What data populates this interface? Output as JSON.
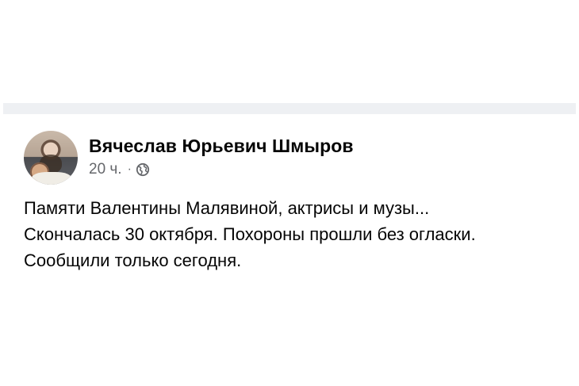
{
  "post": {
    "author": "Вячеслав Юрьевич Шмыров",
    "time": "20 ч.",
    "separator": "·",
    "privacy_icon": "globe-icon",
    "lines": [
      "Памяти Валентины Малявиной, актрисы и музы...",
      "Скончалась 30 октября. Похороны прошли без огласки.",
      "Сообщили только сегодня."
    ]
  },
  "colors": {
    "text_primary": "#050505",
    "text_secondary": "#65676b",
    "divider": "#eef0f3"
  }
}
